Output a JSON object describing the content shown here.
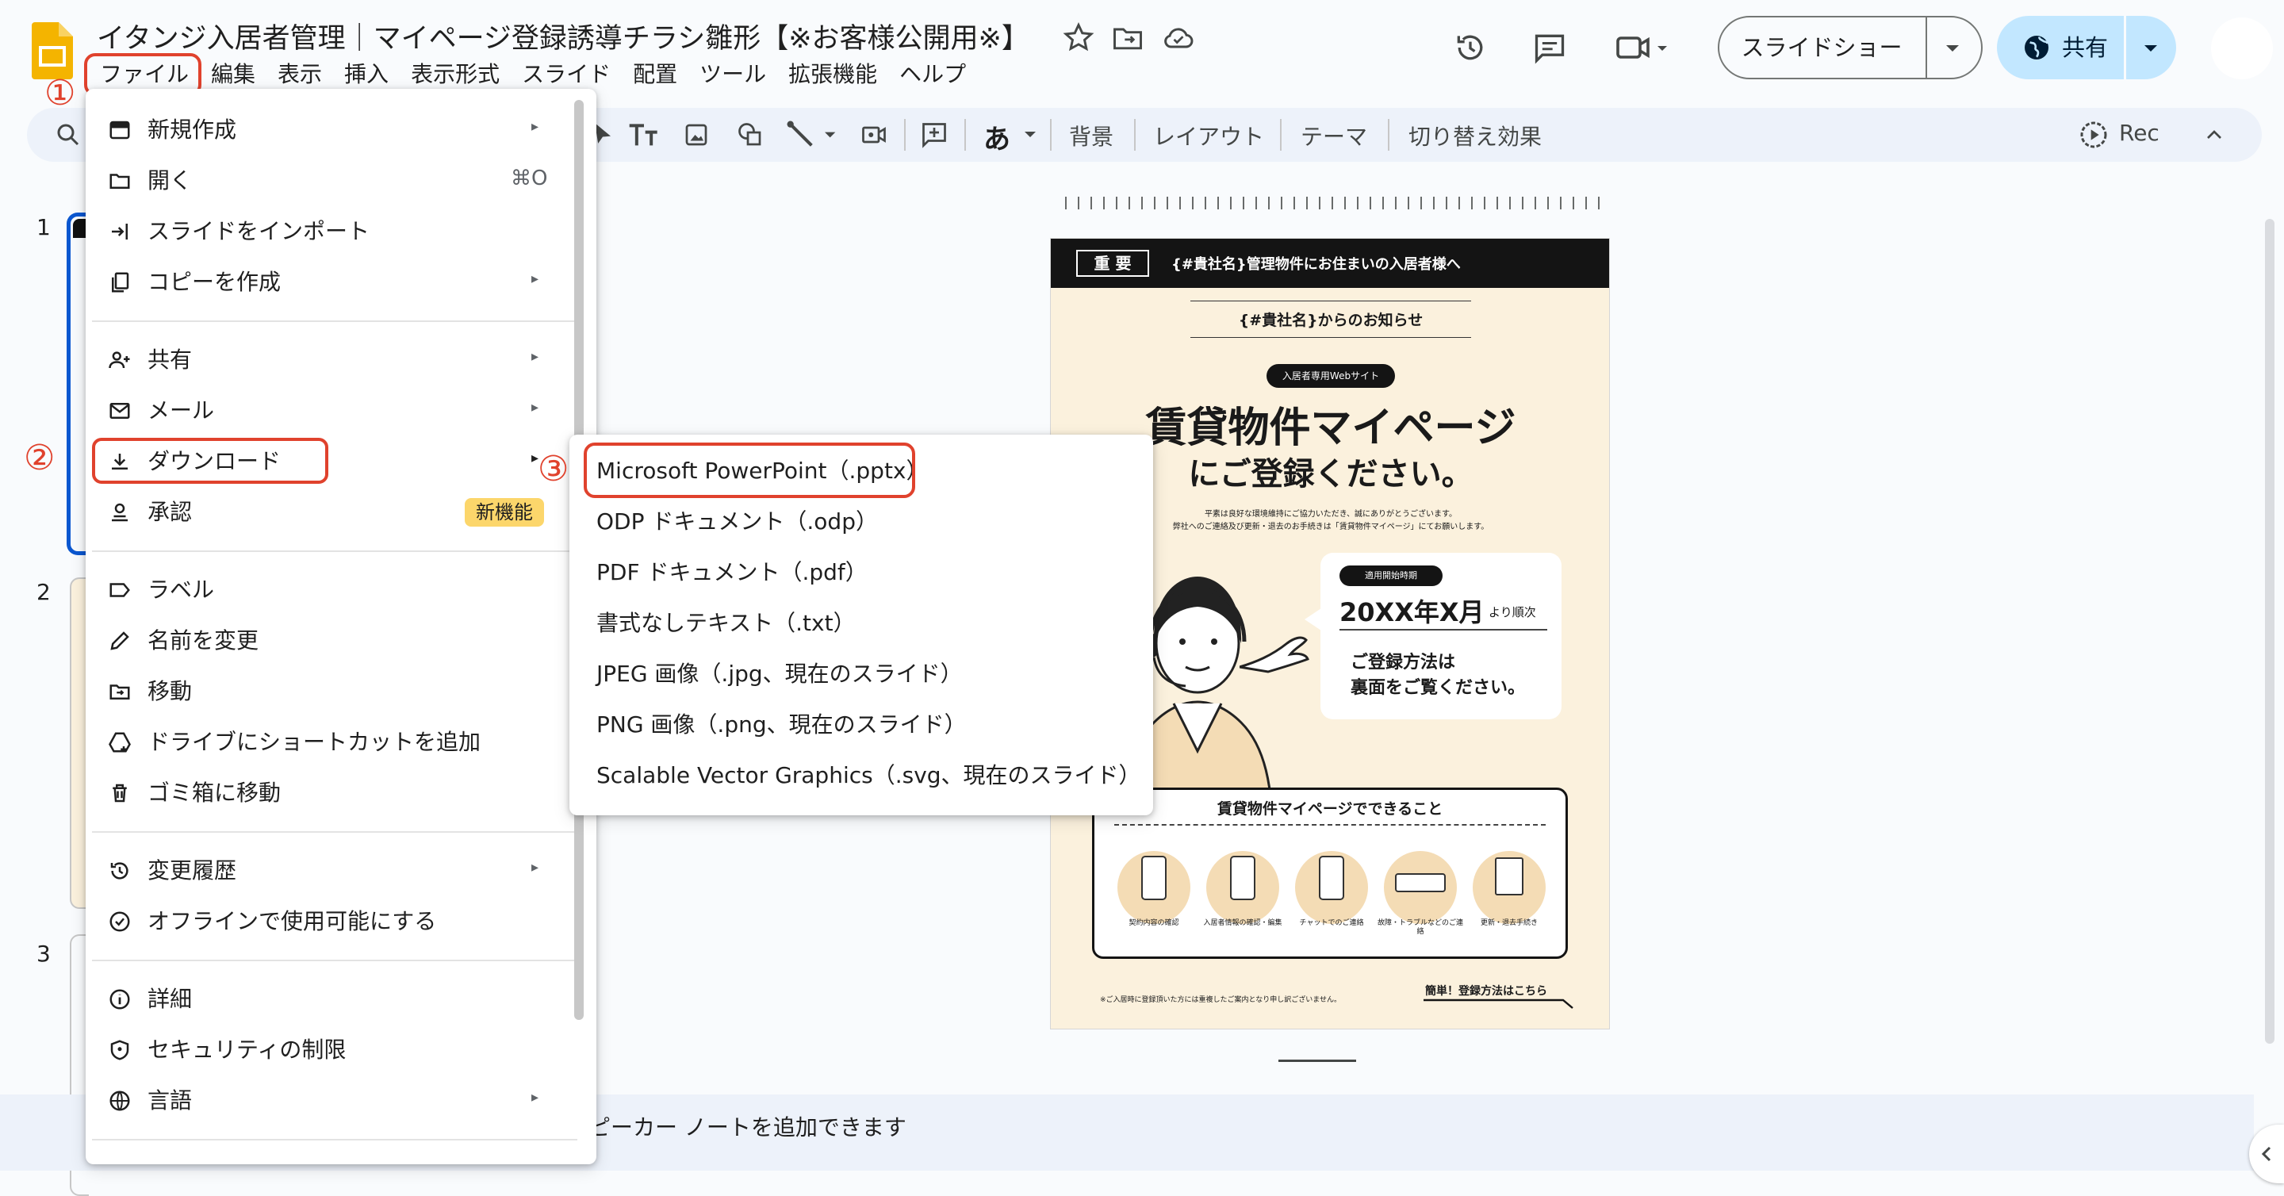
{
  "app": {
    "title": "イタンジ入居者管理｜マイページ登録誘導チラシ雛形【※お客様公開用※】",
    "menus": [
      "ファイル",
      "編集",
      "表示",
      "挿入",
      "表示形式",
      "スライド",
      "配置",
      "ツール",
      "拡張機能",
      "ヘルプ"
    ],
    "slideshow_label": "スライドショー",
    "share_label": "共有"
  },
  "toolbar": {
    "items": [
      "背景",
      "レイアウト",
      "テーマ",
      "切り替え効果"
    ],
    "rec_label": "Rec",
    "ime_label": "あ"
  },
  "annotations": {
    "one": "①",
    "two": "②",
    "three": "③"
  },
  "filmstrip": {
    "numbers": [
      "1",
      "2",
      "3"
    ]
  },
  "file_menu": {
    "new": "新規作成",
    "open": "開く",
    "open_shortcut": "⌘O",
    "import": "スライドをインポート",
    "copy": "コピーを作成",
    "share": "共有",
    "email": "メール",
    "download": "ダウンロード",
    "approval": "承認",
    "new_badge": "新機能",
    "label": "ラベル",
    "rename": "名前を変更",
    "move": "移動",
    "shortcut": "ドライブにショートカットを追加",
    "trash": "ゴミ箱に移動",
    "history": "変更履歴",
    "offline": "オフラインで使用可能にする",
    "details": "詳細",
    "security": "セキュリティの制限",
    "language": "言語",
    "arrow": "▸"
  },
  "download_menu": {
    "items": [
      "Microsoft PowerPoint（.pptx）",
      "ODP ドキュメント（.odp）",
      "PDF ドキュメント（.pdf）",
      "書式なしテキスト（.txt）",
      "JPEG 画像（.jpg、現在のスライド）",
      "PNG 画像（.png、現在のスライド）",
      "Scalable Vector Graphics（.svg、現在のスライド）"
    ]
  },
  "notes": {
    "text": "ピーカー ノートを追加できます"
  },
  "slide": {
    "badge": "重 要",
    "banner": "{#貴社名}管理物件にお住まいの入居者様へ",
    "notice": "{#貴社名}からのお知らせ",
    "pill": "入居者専用Webサイト",
    "headline1": "賃貸物件マイページ",
    "headline2": "にご登録ください。",
    "body1": "平素は良好な環境維持にご協力いただき、誠にありがとうございます。",
    "body2": "弊社へのご連絡及び更新・退去のお手続きは「賃貸物件マイページ」にてお願いします。",
    "date_badge": "適用開始時期",
    "date": "20XX年X月",
    "date_suffix": "より順次",
    "how1": "ご登録方法は",
    "how2": "裏面をご覧ください。",
    "features_title": "賃貸物件マイページでできること",
    "features": [
      "契約内容の確認",
      "入居者情報の確認・編集",
      "チャットでのご連絡",
      "故障・トラブルなどのご連絡",
      "更新・退去手続き"
    ],
    "footnote": "※ご入居時に登録頂いた方には重複したご案内となり申し訳ございません。",
    "easy": "簡単！登録方法はこちら"
  }
}
